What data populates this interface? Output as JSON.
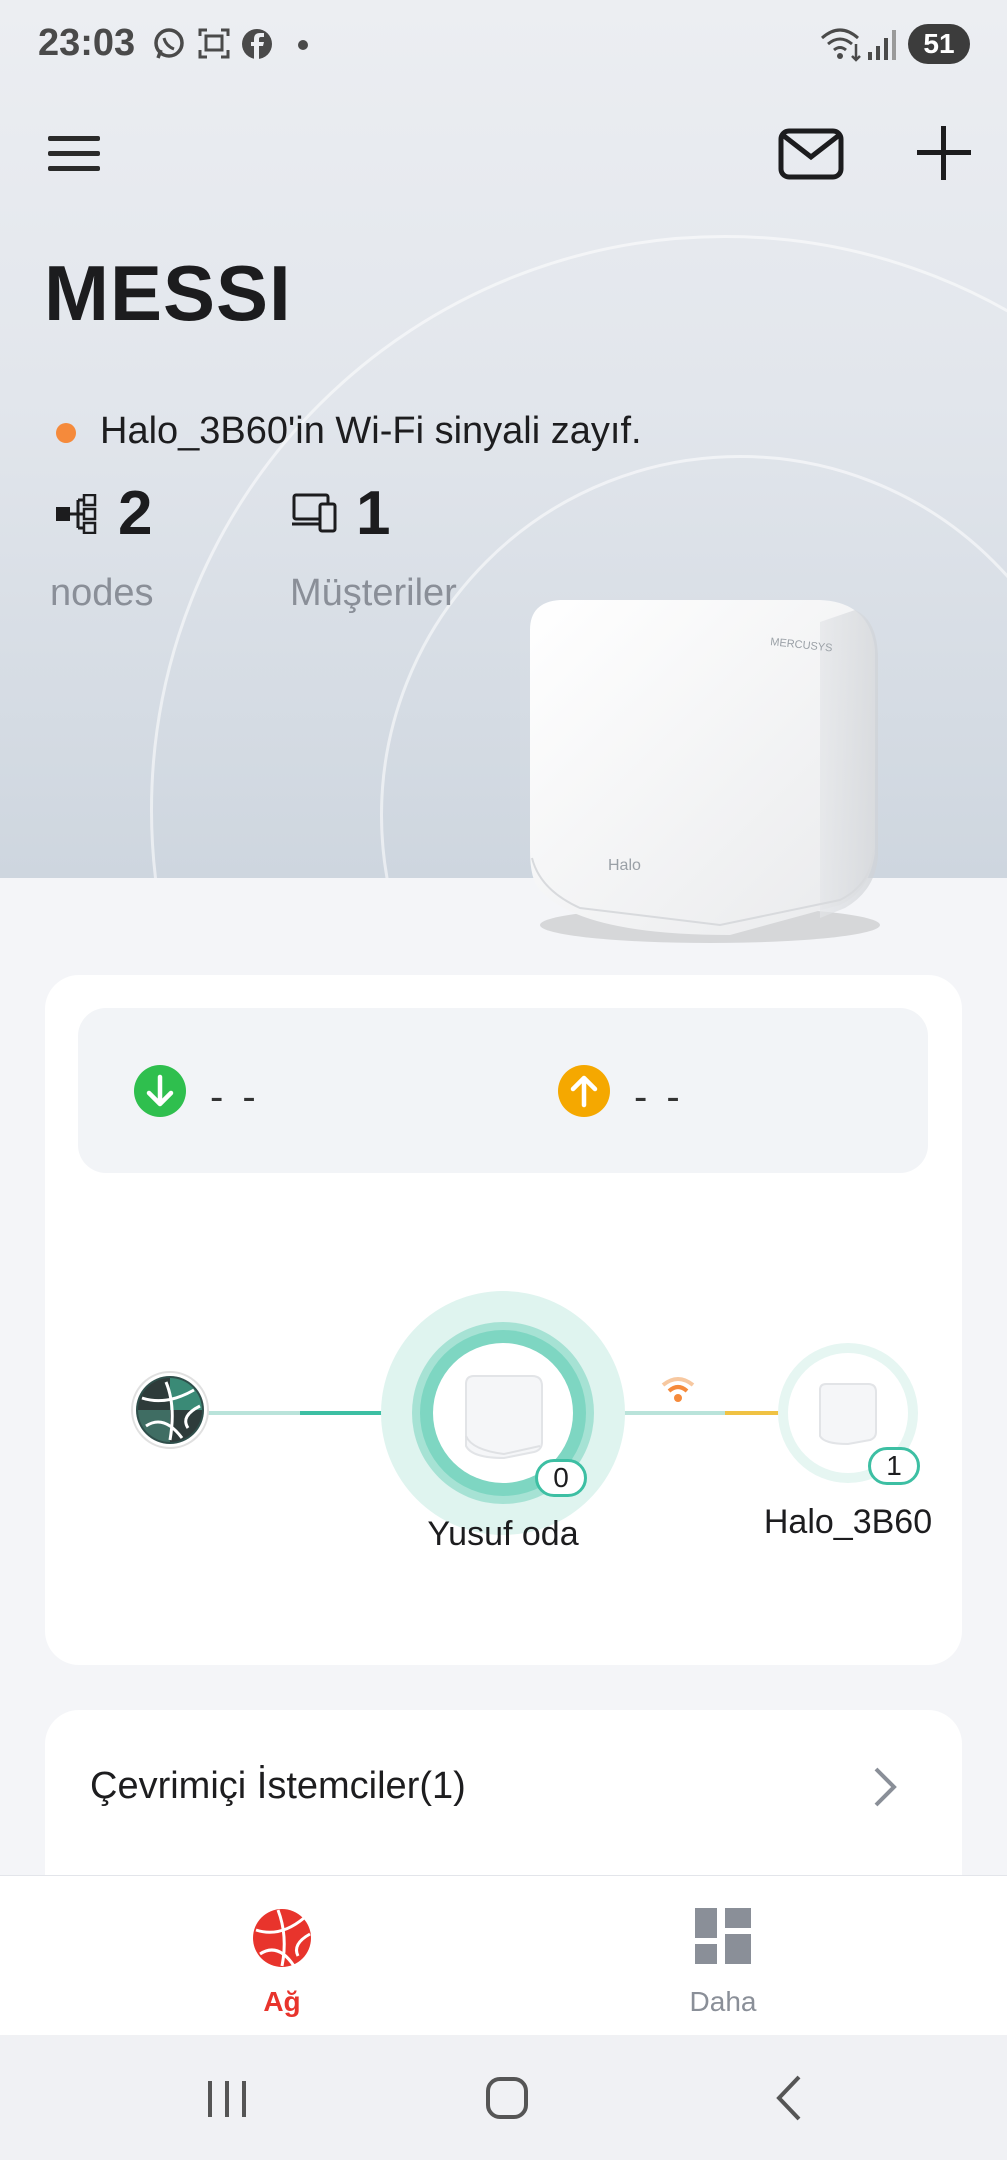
{
  "status_bar": {
    "time": "23:03",
    "battery": "51"
  },
  "header": {
    "network_name": "MESSI"
  },
  "alert": {
    "text": "Halo_3B60'in Wi-Fi sinyali zayıf.",
    "dot_color": "#f58a3b"
  },
  "stats": [
    {
      "icon": "nodes-icon",
      "value": "2",
      "label": "nodes"
    },
    {
      "icon": "devices-icon",
      "value": "1",
      "label": "Müşteriler"
    }
  ],
  "device_image": {
    "brand_text": "MERCUSYS",
    "model_text": "Halo"
  },
  "speed": {
    "download": {
      "icon": "download-arrow-icon",
      "value": "- -",
      "color": "#2fbf4e"
    },
    "upload": {
      "icon": "upload-arrow-icon",
      "value": "- -",
      "color": "#f5a800"
    }
  },
  "topology": {
    "internet": {
      "icon": "internet-globe-icon"
    },
    "main_node": {
      "name": "Yusuf oda",
      "clients": "0"
    },
    "satellite_node": {
      "name": "Halo_3B60",
      "clients": "1",
      "signal": "weak"
    },
    "colors": {
      "accent": "#3dbfa3",
      "weak": "#f0c243",
      "wifi": "#f58a3b"
    }
  },
  "online_clients": {
    "label": "Çevrimiçi İstemciler(1)"
  },
  "tabs": [
    {
      "label": "Ağ",
      "icon": "network-globe-icon",
      "active": true,
      "color": "#e8342c"
    },
    {
      "label": "Daha",
      "icon": "dashboard-grid-icon",
      "active": false,
      "color": "#8a8f98"
    }
  ],
  "nav": [
    "recents-button",
    "home-button",
    "back-button"
  ]
}
